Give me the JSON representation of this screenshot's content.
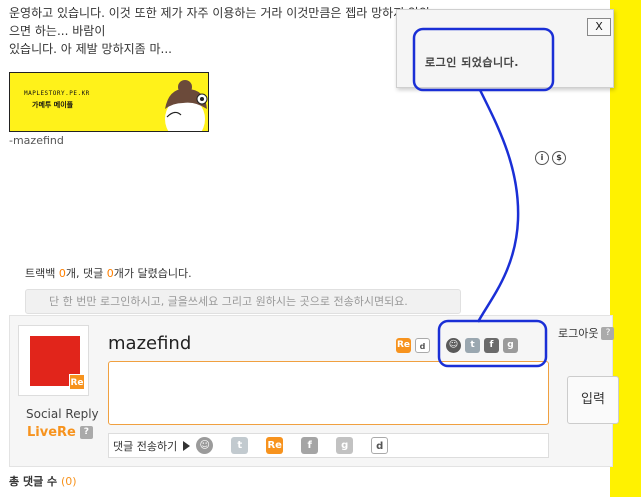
{
  "post": {
    "line1": "운영하고 있습니다. 이것 또한 제가 자주 이용하는 거라 이것만큼은 젭라 망하지 않았으면 하는... 바람이",
    "line2": "있습니다. 아 제발 망하지좀 마..."
  },
  "banner": {
    "url_text": "MAPLESTORY.PE.KR",
    "title_text": "가메투 메이플"
  },
  "signature": "-mazefind",
  "license_icons": [
    "cc-by-icon",
    "cc-nc-icon"
  ],
  "stats": {
    "trackback_label": "트랙백",
    "trackback_count": "0",
    "mid": "개, 댓글",
    "comment_count": "0",
    "suffix": "개가 달렸습니다."
  },
  "hint": "단 한 번만 로그인하시고, 글을쓰세요 그리고 원하시는 곳으로 전송하시면되요.",
  "reply": {
    "username": "mazefind",
    "social_reply": "Social Reply",
    "brand": "LiveRe",
    "help": "?",
    "logout": "로그아웃",
    "textarea_value": "",
    "submit_label": "입력",
    "send_label": "댓글 전송하기",
    "avatar_badge": "Re"
  },
  "top_icons": [
    {
      "name": "livere-icon",
      "glyph": "Re"
    },
    {
      "name": "daum-icon",
      "glyph": "d"
    },
    {
      "name": "me2day-icon",
      "glyph": "☺"
    },
    {
      "name": "twitter-icon",
      "glyph": "t"
    },
    {
      "name": "facebook-icon",
      "glyph": "f"
    },
    {
      "name": "google-icon",
      "glyph": "g"
    }
  ],
  "send_icons": [
    {
      "name": "me2day-icon",
      "glyph": "☺"
    },
    {
      "name": "twitter-icon",
      "glyph": "t"
    },
    {
      "name": "livere-icon",
      "glyph": "Re"
    },
    {
      "name": "facebook-icon",
      "glyph": "f"
    },
    {
      "name": "google-icon",
      "glyph": "g"
    },
    {
      "name": "daum-icon",
      "glyph": "d"
    }
  ],
  "total": {
    "label": "총 댓글 수",
    "count": "(0)"
  },
  "toast": {
    "close_label": "X",
    "message": "로그인 되었습니다."
  },
  "colors": {
    "accent": "#f7931e",
    "annotation": "#1a2fd6",
    "side_strip": "#fff200"
  }
}
